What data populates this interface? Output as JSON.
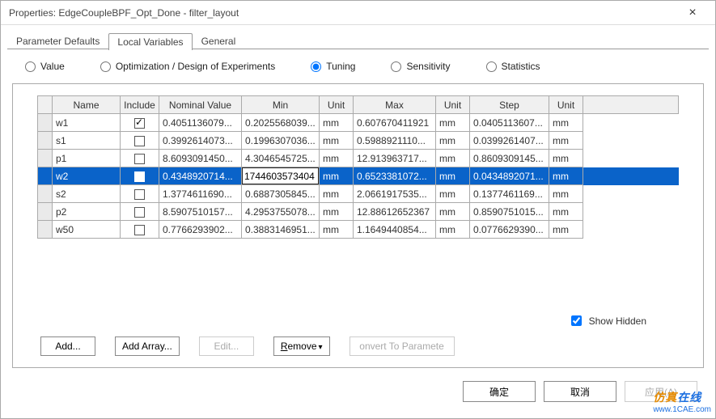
{
  "title": "Properties: EdgeCoupleBPF_Opt_Done - filter_layout",
  "tabs": [
    "Parameter Defaults",
    "Local Variables",
    "General"
  ],
  "active_tab": 1,
  "radios": {
    "options": [
      "Value",
      "Optimization / Design of Experiments",
      "Tuning",
      "Sensitivity",
      "Statistics"
    ],
    "selected": 2
  },
  "columns": [
    "",
    "Name",
    "Include",
    "Nominal Value",
    "Min",
    "Unit",
    "Max",
    "Unit",
    "Step",
    "Unit"
  ],
  "rows": [
    {
      "name": "w1",
      "include": true,
      "nominal": "0.4051136079...",
      "min": "0.2025568039...",
      "unit1": "mm",
      "max": "0.607670411921",
      "unit2": "mm",
      "step": "0.0405113607...",
      "unit3": "mm",
      "selected": false,
      "editing": false
    },
    {
      "name": "s1",
      "include": false,
      "nominal": "0.3992614073...",
      "min": "0.1996307036...",
      "unit1": "mm",
      "max": "0.5988921110...",
      "unit2": "mm",
      "step": "0.0399261407...",
      "unit3": "mm",
      "selected": false,
      "editing": false
    },
    {
      "name": "p1",
      "include": false,
      "nominal": "8.6093091450...",
      "min": "4.3046545725...",
      "unit1": "mm",
      "max": "12.913963717...",
      "unit2": "mm",
      "step": "0.8609309145...",
      "unit3": "mm",
      "selected": false,
      "editing": false
    },
    {
      "name": "w2",
      "include": true,
      "nominal": "0.4348920714...",
      "min": "1744603573404",
      "unit1": "mm",
      "max": "0.6523381072...",
      "unit2": "mm",
      "step": "0.0434892071...",
      "unit3": "mm",
      "selected": true,
      "editing": true
    },
    {
      "name": "s2",
      "include": false,
      "nominal": "1.3774611690...",
      "min": "0.6887305845...",
      "unit1": "mm",
      "max": "2.0661917535...",
      "unit2": "mm",
      "step": "0.1377461169...",
      "unit3": "mm",
      "selected": false,
      "editing": false
    },
    {
      "name": "p2",
      "include": false,
      "nominal": "8.5907510157...",
      "min": "4.2953755078...",
      "unit1": "mm",
      "max": "12.88612652367",
      "unit2": "mm",
      "step": "0.8590751015...",
      "unit3": "mm",
      "selected": false,
      "editing": false
    },
    {
      "name": "w50",
      "include": false,
      "nominal": "0.7766293902...",
      "min": "0.3883146951...",
      "unit1": "mm",
      "max": "1.1649440854...",
      "unit2": "mm",
      "step": "0.0776629390...",
      "unit3": "mm",
      "selected": false,
      "editing": false
    }
  ],
  "show_hidden": {
    "label": "Show Hidden",
    "checked": true
  },
  "actions": {
    "add": "Add...",
    "add_array": "Add Array...",
    "edit": "Edit...",
    "remove": "Remove",
    "convert": "onvert To Paramete"
  },
  "footer": {
    "ok": "确定",
    "cancel": "取消",
    "apply": "应用(A)"
  },
  "watermark": {
    "line1a": "仿真",
    "line1b": "在线",
    "url": "www.1CAE.com"
  }
}
